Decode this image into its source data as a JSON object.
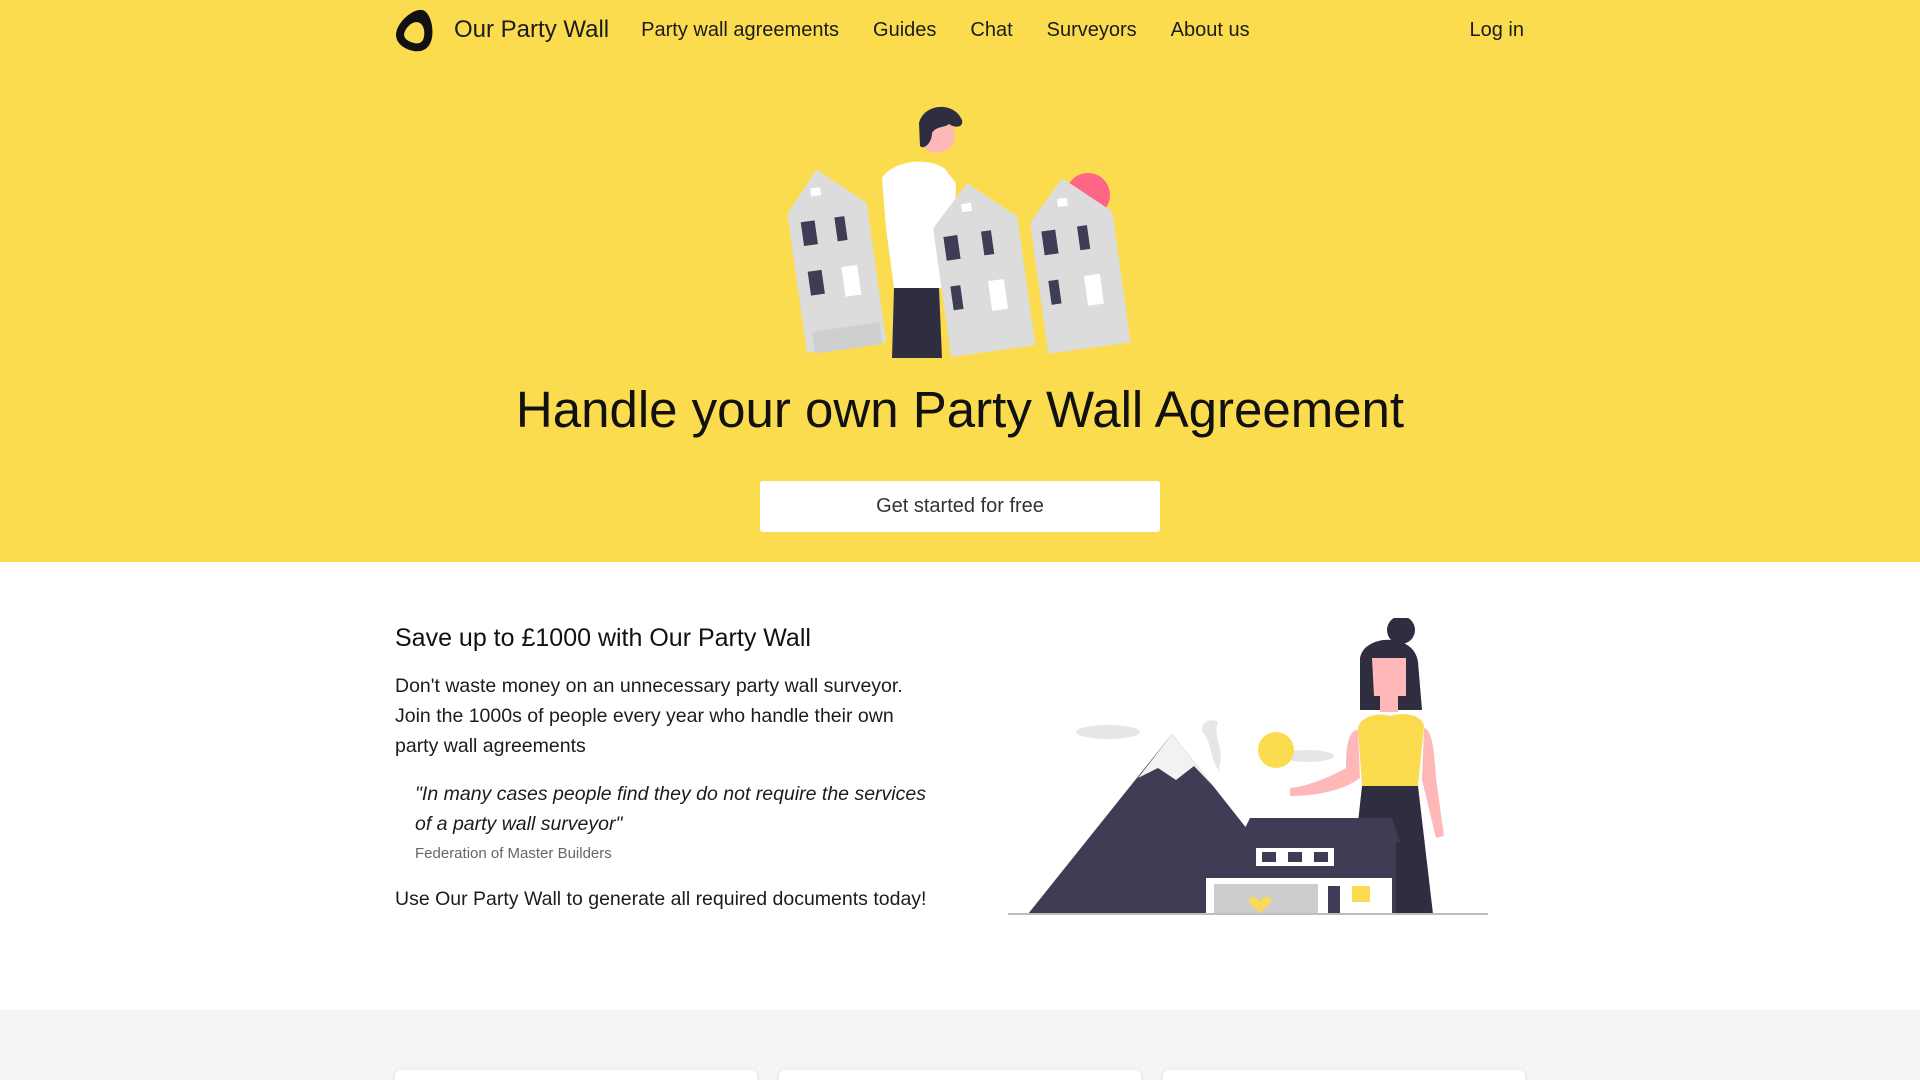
{
  "nav": {
    "brand": "Our Party Wall",
    "links": [
      "Party wall agreements",
      "Guides",
      "Chat",
      "Surveyors",
      "About us"
    ],
    "login": "Log in"
  },
  "hero": {
    "title": "Handle your own Party Wall Agreement",
    "cta": "Get started for free",
    "background_color": "#fbdc4f"
  },
  "savings": {
    "heading": "Save up to £1000 with Our Party Wall",
    "paragraph": "Don't waste money on an unnecessary party wall surveyor. Join the 1000s of people every year who handle their own party wall agreements",
    "quote": "\"In many cases people find they do not require the services of a party wall surveyor\"",
    "quote_source": "Federation of Master Builders",
    "closing": "Use Our Party Wall to generate all required documents today!"
  },
  "icons": {
    "logo": "our-party-wall-logo-icon",
    "hero_illustration": "person-with-houses-illustration",
    "section_illustration": "woman-with-house-and-mountain-illustration"
  }
}
